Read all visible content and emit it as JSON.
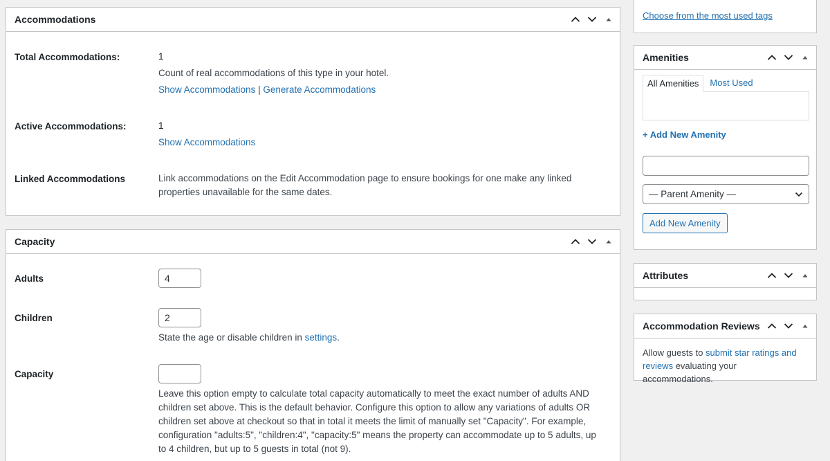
{
  "accommodations_box": {
    "title": "Accommodations",
    "total": {
      "label": "Total Accommodations:",
      "value": "1",
      "description": "Count of real accommodations of this type in your hotel.",
      "show_link": "Show Accommodations",
      "separator": "|",
      "generate_link": "Generate Accommodations"
    },
    "active": {
      "label": "Active Accommodations:",
      "value": "1",
      "show_link": "Show Accommodations"
    },
    "linked": {
      "label": "Linked Accommodations",
      "description": "Link accommodations on the Edit Accommodation page to ensure bookings for one make any linked properties unavailable for the same dates."
    }
  },
  "capacity_box": {
    "title": "Capacity",
    "adults": {
      "label": "Adults",
      "value": "4"
    },
    "children": {
      "label": "Children",
      "value": "2",
      "description_before": "State the age or disable children in ",
      "settings_link": "settings",
      "description_after": "."
    },
    "capacity": {
      "label": "Capacity",
      "value": "",
      "description": "Leave this option empty to calculate total capacity automatically to meet the exact number of adults AND children set above. This is the default behavior. Configure this option to allow any variations of adults OR children set above at checkout so that in total it meets the limit of manually set \"Capacity\". For example, configuration \"adults:5\", \"children:4\", \"capacity:5\" means the property can accommodate up to 5 adults, up to 4 children, but up to 5 guests in total (not 9)."
    }
  },
  "tags_box": {
    "most_used_link": "Choose from the most used tags"
  },
  "amenities_box": {
    "title": "Amenities",
    "tabs": [
      "All Amenities",
      "Most Used"
    ],
    "add_new_link": "+ Add New Amenity",
    "new_amenity_value": "",
    "parent_select": "— Parent Amenity —",
    "add_button": "Add New Amenity"
  },
  "attributes_box": {
    "title": "Attributes"
  },
  "reviews_box": {
    "title": "Accommodation Reviews",
    "text_before": "Allow guests to ",
    "link": "submit star ratings and reviews",
    "text_after": " evaluating your accommodations."
  },
  "icons": {
    "move_up": "chevron-up-icon",
    "move_down": "chevron-down-icon",
    "toggle": "caret-up-icon"
  },
  "colors": {
    "link": "#2271b1",
    "border": "#c3c4c7",
    "background": "#f0f0f1"
  }
}
